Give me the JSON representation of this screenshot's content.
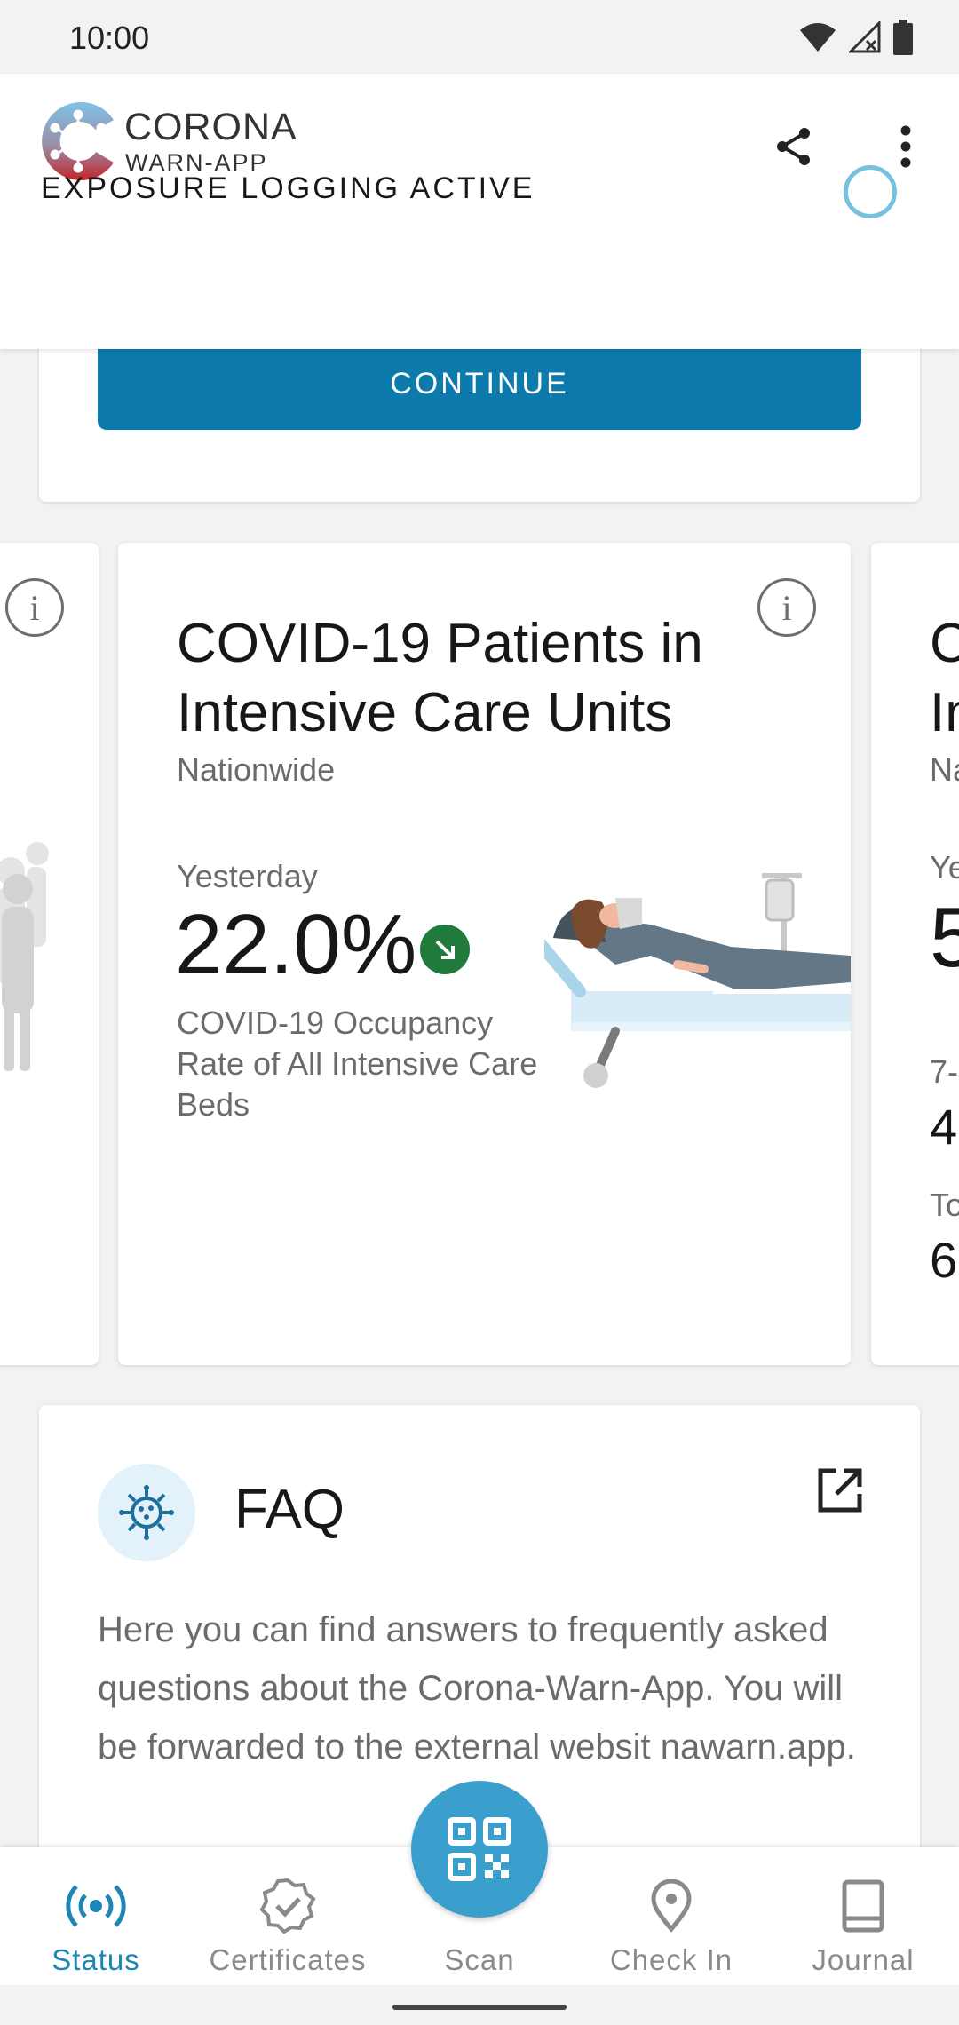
{
  "status_bar": {
    "time": "10:00"
  },
  "app_bar": {
    "brand_name": "CORONA",
    "brand_sub": "WARN-APP",
    "exposure_label": "EXPOSURE LOGGING ACTIVE"
  },
  "top_card": {
    "continue_label": "CONTINUE"
  },
  "stats_main": {
    "title": "COVID-19 Patients in Intensive Care Units",
    "region": "Nationwide",
    "period": "Yesterday",
    "value": "22.0%",
    "trend": "decreasing",
    "description": "COVID-19 Occupancy Rate of All Intensive Care Beds"
  },
  "stats_right_partial": {
    "title_line1": "C",
    "title_line2": "In",
    "region": "Na",
    "period": "Ye",
    "value": "5",
    "label2": "7-",
    "value2": "4",
    "label3": "To",
    "value3": "6,"
  },
  "faq": {
    "title": "FAQ",
    "body": "Here you can find answers to frequently asked questions about the Corona-Warn-App. You will be forwarded to the external websit        nawarn.app."
  },
  "bottom_nav": {
    "items": [
      {
        "label": "Status",
        "icon": "broadcast-icon",
        "active": true
      },
      {
        "label": "Certificates",
        "icon": "certificate-badge-icon",
        "active": false
      },
      {
        "label": "Scan",
        "icon": "qr-code-icon",
        "active": false
      },
      {
        "label": "Check In",
        "icon": "location-pin-icon",
        "active": false
      },
      {
        "label": "Journal",
        "icon": "book-icon",
        "active": false
      }
    ]
  },
  "colors": {
    "accent": "#0c7aab",
    "fab": "#3a9fcd",
    "active_nav": "#1d86b6",
    "trend_down": "#1f7a3b",
    "exposure_ring": "#76c2dd"
  }
}
